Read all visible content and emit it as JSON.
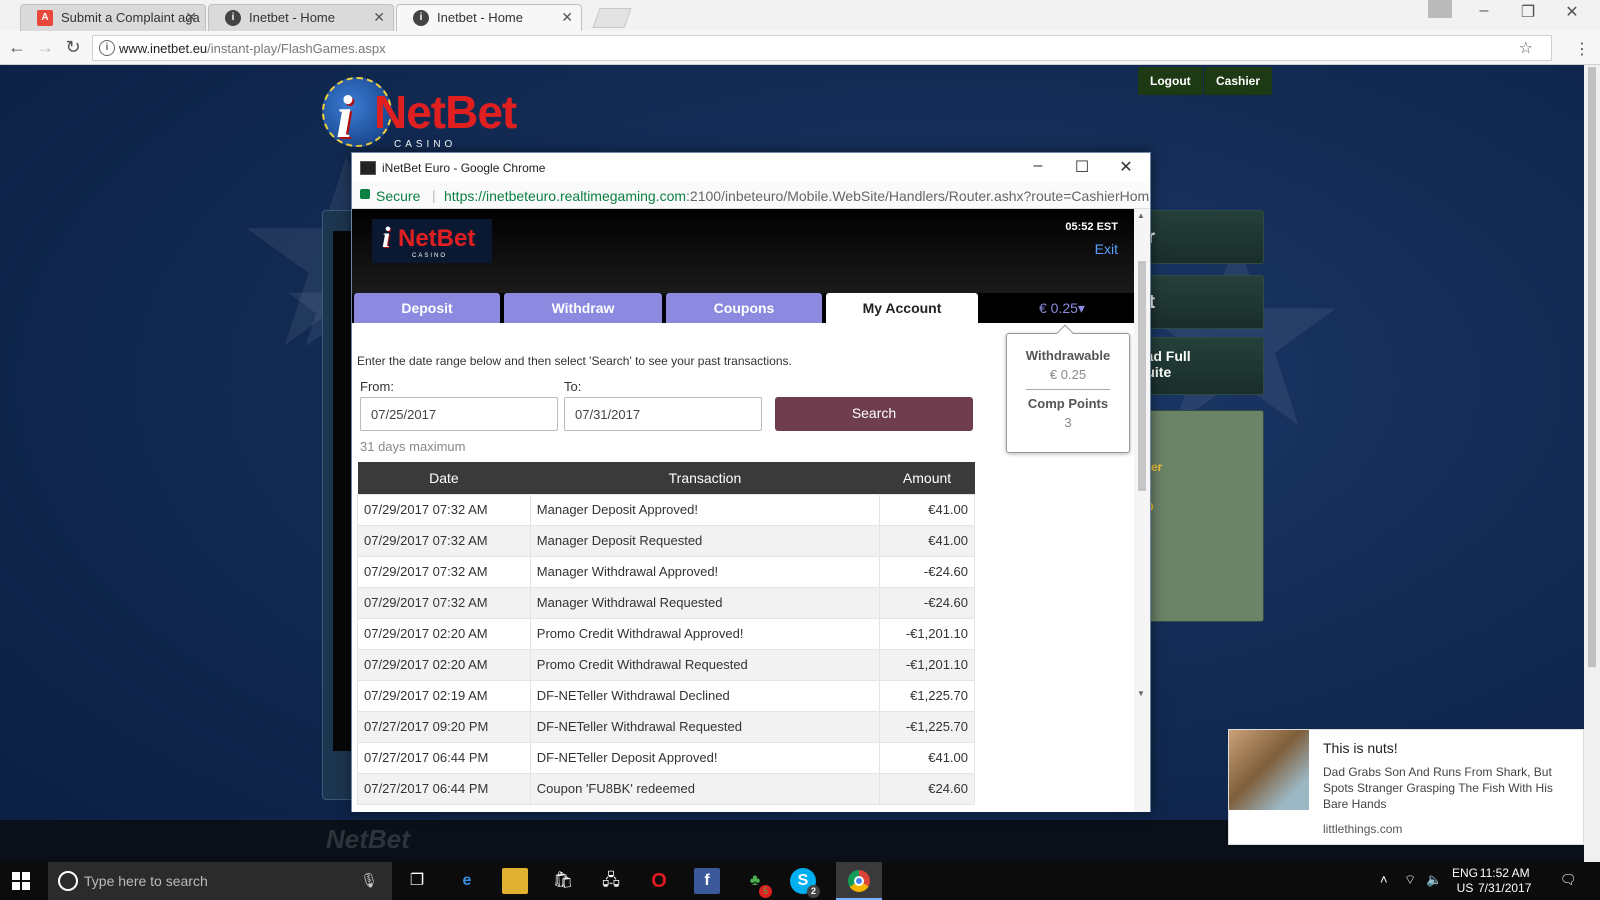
{
  "browser": {
    "tabs": [
      {
        "title": "Submit a Complaint aga",
        "icon": "red-a-icon"
      },
      {
        "title": "Inetbet - Home",
        "icon": "site-icon"
      },
      {
        "title": "Inetbet - Home",
        "icon": "site-icon",
        "active": true
      }
    ],
    "url_host": "www.inetbet.eu",
    "url_path": "/instant-play/FlashGames.aspx"
  },
  "page": {
    "logo_i": "i",
    "logo_net": "NetBet",
    "logo_casino": "CASINO",
    "logout_label": "Logout",
    "cashier_label": "Cashier",
    "side_items": [
      "er",
      "ut",
      "oad Full\nSuite"
    ],
    "side_list": [
      "oker",
      "- F",
      "- O",
      "- Z"
    ]
  },
  "popup": {
    "window_title": "iNetBet Euro - Google Chrome",
    "secure_label": "Secure",
    "url_host": "https://inetbeteuro.realtimegaming.com",
    "url_rest": ":2100/inbeteuro/Mobile.WebSite/Handlers/Router.ashx?route=CashierHom",
    "cashier": {
      "time": "05:52 EST",
      "exit_label": "Exit",
      "tabs": [
        "Deposit",
        "Withdraw",
        "Coupons",
        "My Account"
      ],
      "active_tab": "My Account",
      "balance": "€ 0.25▾",
      "hint": "Enter the date range below and then select 'Search' to see your past transactions.",
      "from_label": "From:",
      "to_label": "To:",
      "from_value": "07/25/2017",
      "to_value": "07/31/2017",
      "search_label": "Search",
      "max_note": "31 days maximum",
      "balance_popup": {
        "withdrawable_label": "Withdrawable",
        "withdrawable_value": "€ 0.25",
        "comp_label": "Comp Points",
        "comp_value": "3"
      },
      "table": {
        "headers": [
          "Date",
          "Transaction",
          "Amount"
        ],
        "rows": [
          [
            "07/29/2017 07:32 AM",
            "Manager Deposit Approved!",
            "€41.00"
          ],
          [
            "07/29/2017 07:32 AM",
            "Manager Deposit Requested",
            "€41.00"
          ],
          [
            "07/29/2017 07:32 AM",
            "Manager Withdrawal Approved!",
            "-€24.60"
          ],
          [
            "07/29/2017 07:32 AM",
            "Manager Withdrawal Requested",
            "-€24.60"
          ],
          [
            "07/29/2017 02:20 AM",
            "Promo Credit Withdrawal Approved!",
            "-€1,201.10"
          ],
          [
            "07/29/2017 02:20 AM",
            "Promo Credit Withdrawal Requested",
            "-€1,201.10"
          ],
          [
            "07/29/2017 02:19 AM",
            "DF-NETeller Withdrawal Declined",
            "€1,225.70"
          ],
          [
            "07/27/2017 09:20 PM",
            "DF-NETeller Withdrawal Requested",
            "-€1,225.70"
          ],
          [
            "07/27/2017 06:44 PM",
            "DF-NETeller Deposit Approved!",
            "€41.00"
          ],
          [
            "07/27/2017 06:44 PM",
            "Coupon 'FU8BK' redeemed",
            "€24.60"
          ]
        ]
      }
    }
  },
  "ad": {
    "title": "This is nuts!",
    "text": "Dad Grabs Son And Runs From Shark, But Spots Stranger Grasping The Fish With His Bare Hands",
    "source": "littlethings.com"
  },
  "taskbar": {
    "search_placeholder": "Type here to search",
    "lang_top": "ENG",
    "lang_bottom": "US",
    "time": "11:52 AM",
    "date": "7/31/2017",
    "badges": {
      "green_app": "5",
      "skype": "2"
    }
  }
}
